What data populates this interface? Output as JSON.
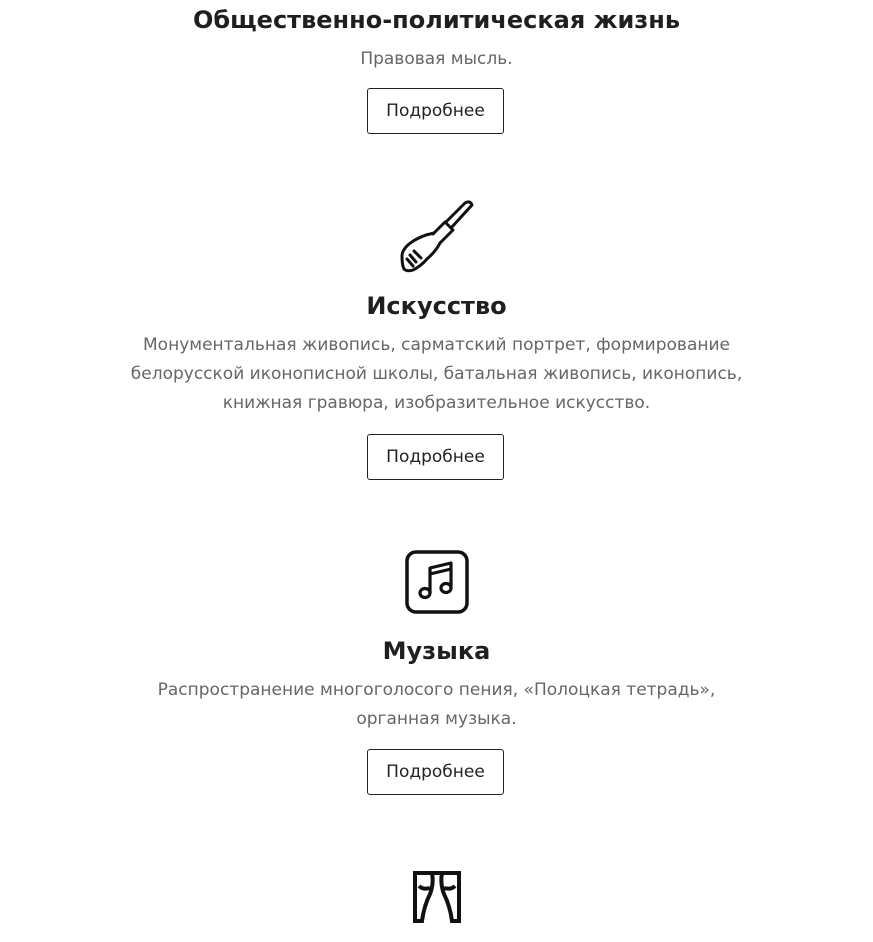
{
  "sections": [
    {
      "title": "Общественно-политическая жизнь",
      "description": "Правовая мысль.",
      "button_label": "Подробнее"
    },
    {
      "icon": "paintbrush-icon",
      "title": "Искусство",
      "description": "Монументальная живопись, сарматский портрет, формирование белорусской иконописной школы, батальная живопись, иконопись, книжная гравюра, изобразительное искусство.",
      "button_label": "Подробнее"
    },
    {
      "icon": "music-note-icon",
      "title": "Музыка",
      "description": "Распространение многоголосого пения, «Полоцкая тетрадь», органная музыка.",
      "button_label": "Подробнее"
    },
    {
      "icon": "theater-curtain-icon"
    }
  ]
}
